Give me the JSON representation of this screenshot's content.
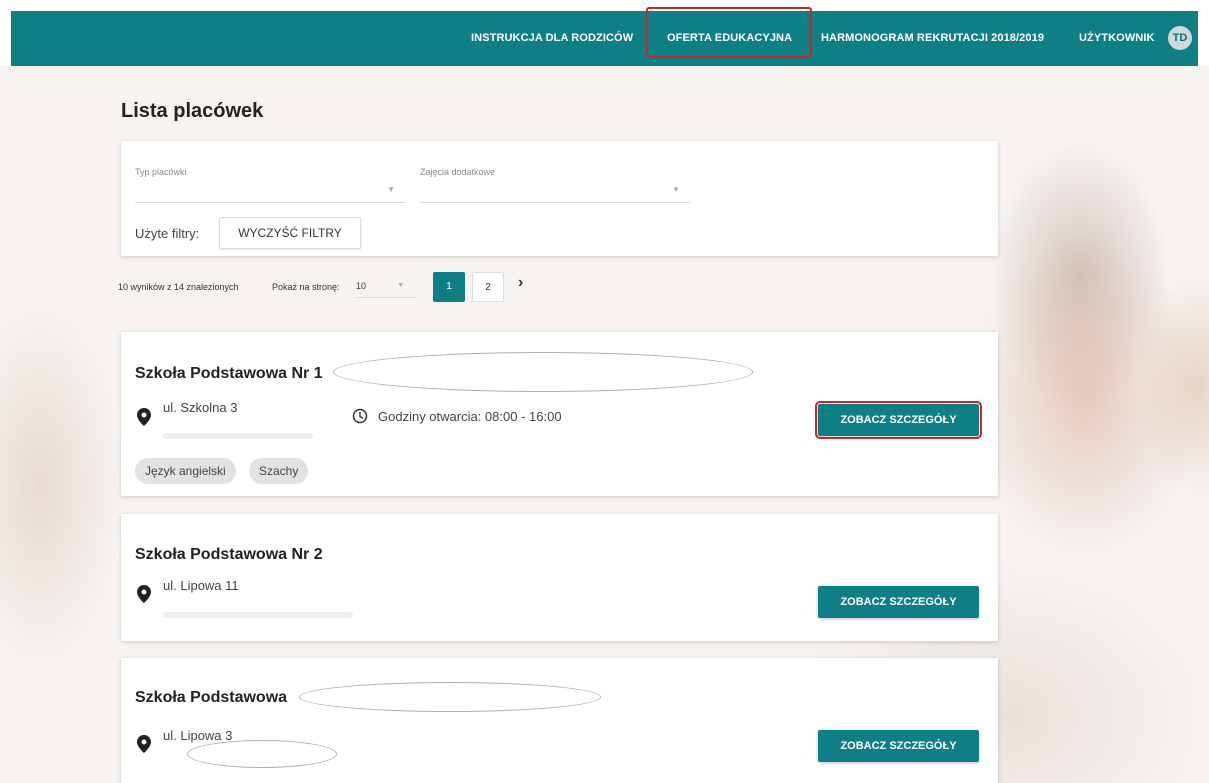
{
  "nav": {
    "items": [
      {
        "label": "INSTRUKCJA DLA RODZICÓW"
      },
      {
        "label": "OFERTA EDUKACYJNA"
      },
      {
        "label": "HARMONOGRAM REKRUTACJI 2018/2019"
      },
      {
        "label": "UŻYTKOWNIK"
      }
    ],
    "avatar_initials": "TD",
    "accent_color": "#0f7f86",
    "highlight_color": "#c62828"
  },
  "page": {
    "title": "Lista placówek"
  },
  "filters": {
    "type_label": "Typ placówki",
    "extra_label": "Zajęcia dodatkowe",
    "used_filters_label": "Użyte filtry:",
    "clear_button": "WYCZYŚĆ FILTRY"
  },
  "pagination": {
    "results_text": "10 wyników z 14 znalezionych",
    "per_page_label": "Pokaż na stronę:",
    "per_page_value": "10",
    "pages": [
      "1",
      "2"
    ],
    "current_page": "1",
    "next_icon": "chevron-right-icon"
  },
  "schools": [
    {
      "name": "Szkoła Podstawowa Nr 1",
      "address": "ul. Szkolna 3",
      "hours": "Godziny otwarcia: 08:00 - 16:00",
      "button": "ZOBACZ SZCZEGÓŁY",
      "tags": [
        "Język angielski",
        "Szachy"
      ]
    },
    {
      "name": "Szkoła Podstawowa Nr 2",
      "address": "ul. Lipowa 11",
      "button": "ZOBACZ SZCZEGÓŁY"
    },
    {
      "name": "Szkoła Podstawowa",
      "address": "ul. Lipowa 3",
      "button": "ZOBACZ SZCZEGÓŁY"
    }
  ]
}
